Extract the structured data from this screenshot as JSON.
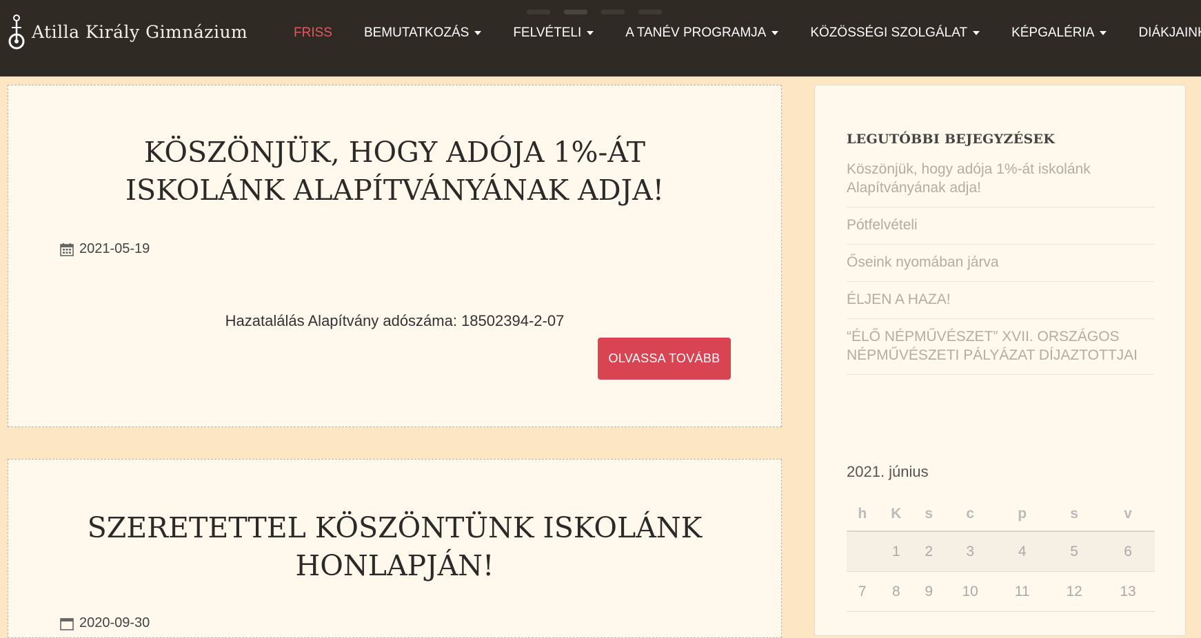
{
  "brand": {
    "name": "Atilla Király Gimnázium"
  },
  "nav": {
    "items": [
      {
        "label": "FRISS",
        "active": true,
        "dropdown": false
      },
      {
        "label": "BEMUTATKOZÁS",
        "active": false,
        "dropdown": true
      },
      {
        "label": "FELVÉTELI",
        "active": false,
        "dropdown": true
      },
      {
        "label": "A TANÉV PROGRAMJA",
        "active": false,
        "dropdown": true
      },
      {
        "label": "KÖZÖSSÉGI SZOLGÁLAT",
        "active": false,
        "dropdown": true
      },
      {
        "label": "KÉPGALÉRIA",
        "active": false,
        "dropdown": true
      },
      {
        "label": "DIÁKJAINK",
        "active": false,
        "dropdown": true
      }
    ]
  },
  "posts": [
    {
      "title": "Köszönjük, hogy adója 1%-át iskolánk Alapítványának adja!",
      "date": "2021-05-19",
      "excerpt": "Hazatalálás Alapítvány adószáma: 18502394-2-07",
      "read_more_label": "OLVASSA TOVÁBB"
    },
    {
      "title": "Szeretettel köszöntünk iskolánk honlapján!",
      "date": "2020-09-30"
    }
  ],
  "sidebar": {
    "recent_title": "Legutóbbi bejegyzések",
    "recent": [
      "Köszönjük, hogy adója 1%-át iskolánk Alapítványának adja!",
      "Pótfelvételi",
      "Őseink nyomában járva",
      "ÉLJEN A HAZA!",
      "“ÉLŐ NÉPMŰVÉSZET” XVII. ORSZÁGOS NÉPMŰVÉSZETI PÁLYÁZAT DÍJAZTOTTJAI"
    ],
    "calendar": {
      "caption": "2021. június",
      "weekdays": [
        "h",
        "K",
        "s",
        "c",
        "p",
        "s",
        "v"
      ],
      "weeks": [
        [
          "",
          "1",
          "2",
          "3",
          "4",
          "5",
          "6"
        ],
        [
          "7",
          "8",
          "9",
          "10",
          "11",
          "12",
          "13"
        ]
      ]
    }
  },
  "colors": {
    "topbar": "#2f2a24",
    "accent": "#d94452",
    "active_nav": "#e05a63",
    "page_bg": "#fde6c4",
    "card_bg": "#fff8ec"
  },
  "icons": {
    "brand": "logo-icon",
    "date": "calendar-icon",
    "dropdown": "caret-down-icon"
  }
}
